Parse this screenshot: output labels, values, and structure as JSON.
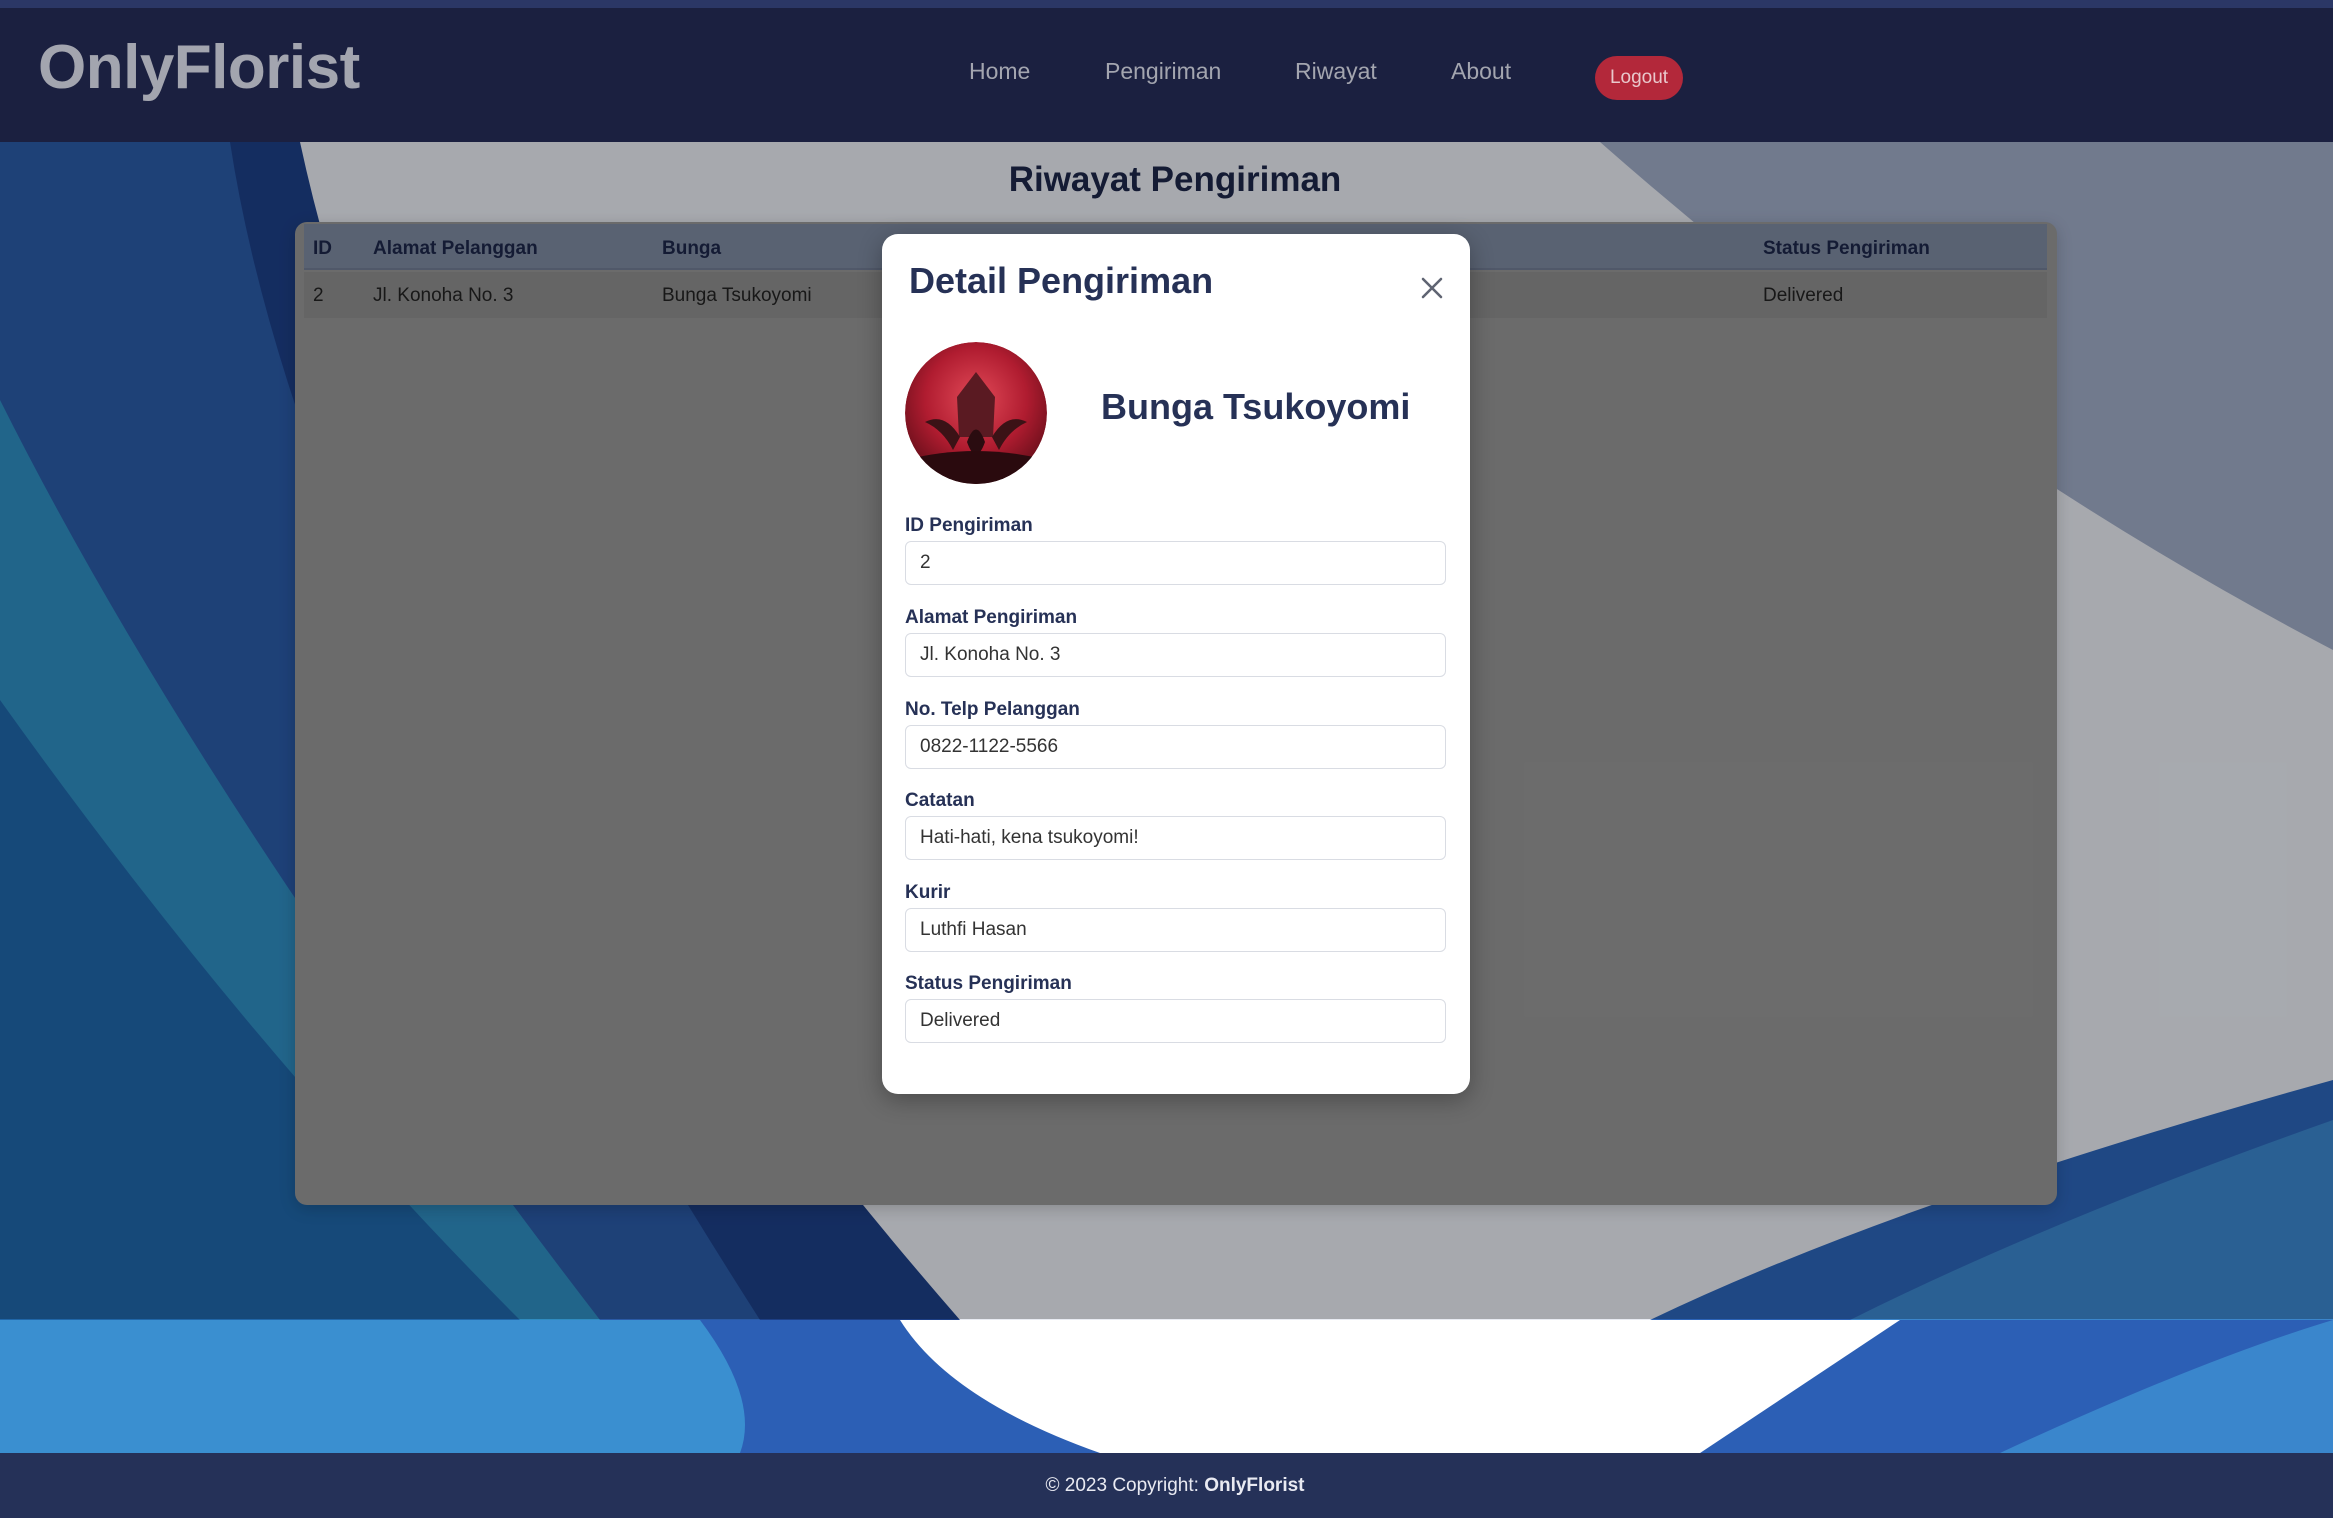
{
  "app": {
    "brand": "OnlyFlorist"
  },
  "nav": {
    "home": "Home",
    "pengiriman": "Pengiriman",
    "riwayat": "Riwayat",
    "about": "About",
    "logout": "Logout"
  },
  "page": {
    "title": "Riwayat Pengiriman"
  },
  "table": {
    "headers": {
      "id": "ID",
      "alamat": "Alamat Pelanggan",
      "bunga": "Bunga",
      "status": "Status Pengiriman"
    },
    "rows": [
      {
        "id": "2",
        "alamat": "Jl. Konoha No. 3",
        "bunga": "Bunga Tsukoyomi",
        "status": "Delivered"
      }
    ]
  },
  "modal": {
    "title": "Detail Pengiriman",
    "flower_name": "Bunga Tsukoyomi",
    "fields": {
      "id_label": "ID Pengiriman",
      "id_value": "2",
      "alamat_label": "Alamat Pengiriman",
      "alamat_value": "Jl. Konoha No. 3",
      "telp_label": "No. Telp Pelanggan",
      "telp_value": "0822-1122-5566",
      "catatan_label": "Catatan",
      "catatan_value": "Hati-hati, kena tsukoyomi!",
      "kurir_label": "Kurir",
      "kurir_value": "Luthfi Hasan",
      "status_label": "Status Pengiriman",
      "status_value": "Delivered"
    }
  },
  "footer": {
    "prefix": "© 2023 Copyright: ",
    "brand": "OnlyFlorist"
  },
  "colors": {
    "navbar": "#1b2040",
    "accent_logout": "#b3283a",
    "title_text": "#263156",
    "footer": "#253158"
  }
}
